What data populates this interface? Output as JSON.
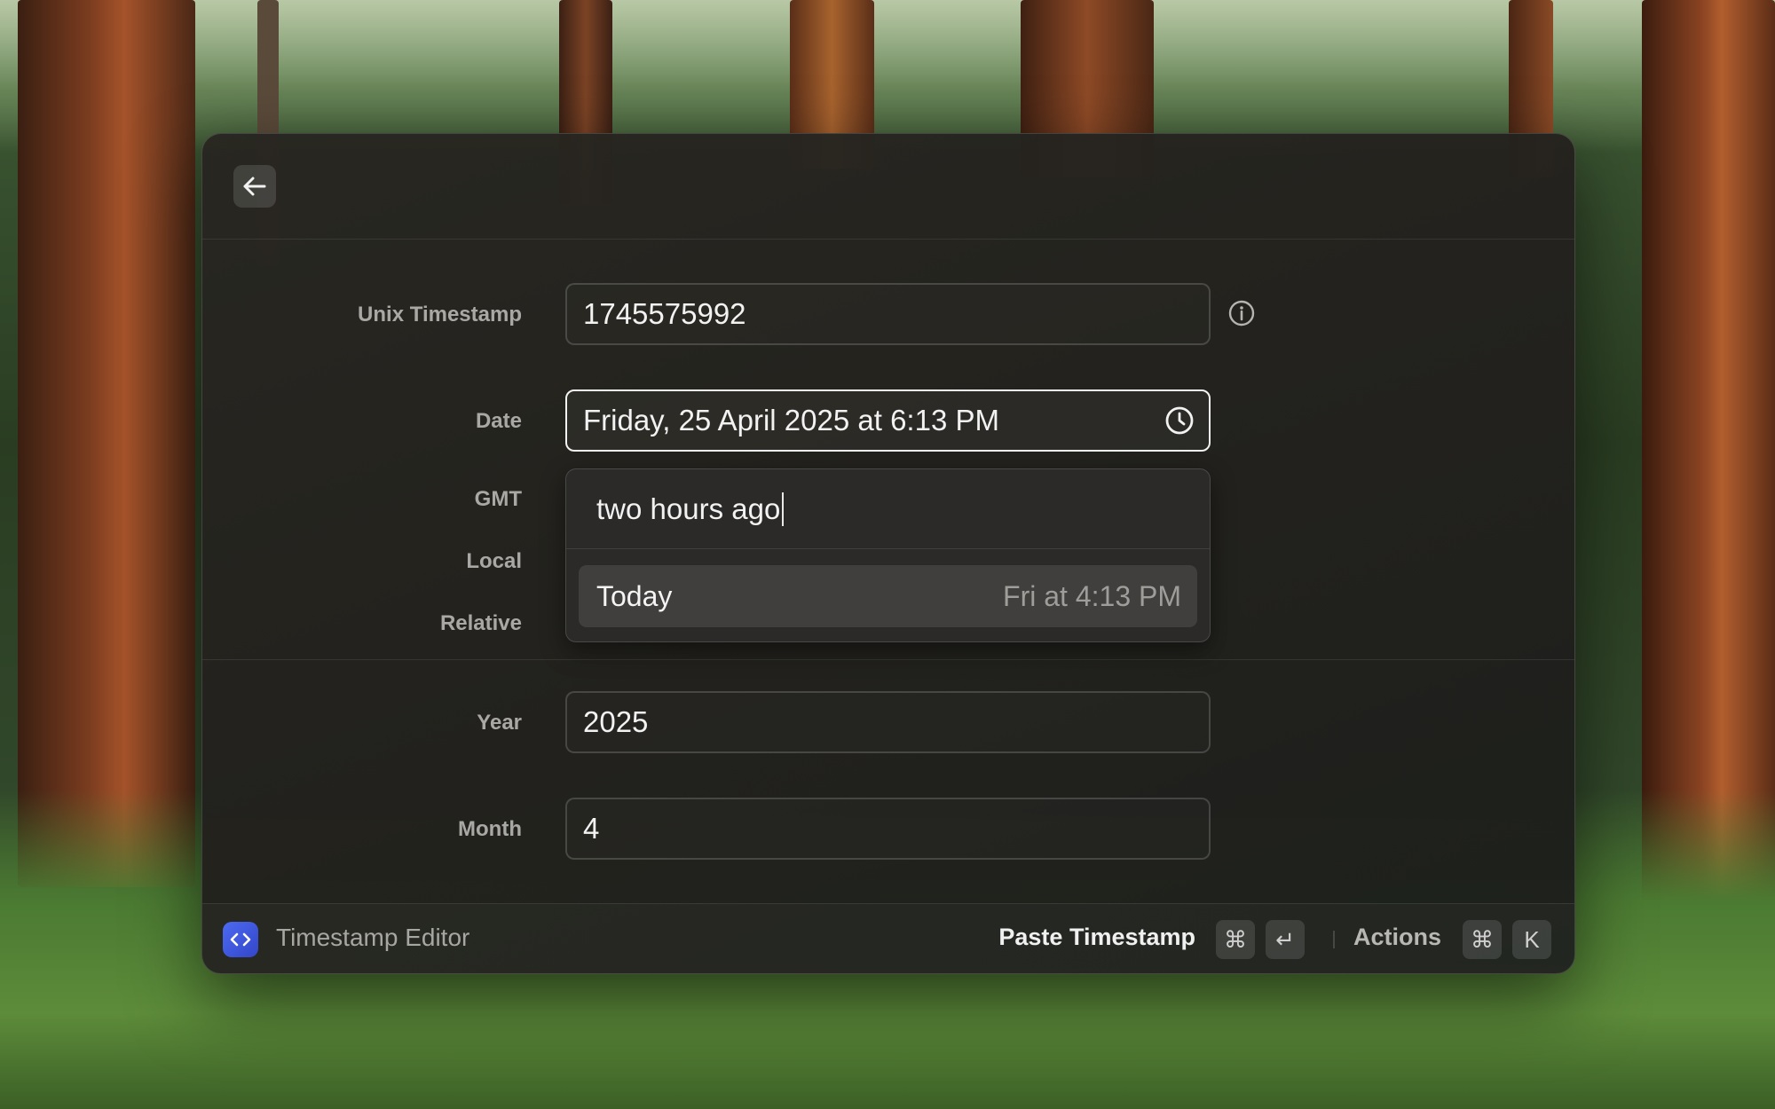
{
  "window": {
    "back_icon": "arrow-left-icon"
  },
  "form": {
    "unix_timestamp": {
      "label": "Unix Timestamp",
      "value": "1745575992",
      "info_icon": "info-icon"
    },
    "date": {
      "label": "Date",
      "value": "Friday, 25 April 2025 at 6:13 PM",
      "icon": "clock-icon"
    },
    "gmt": {
      "label": "GMT"
    },
    "local": {
      "label": "Local"
    },
    "relative": {
      "label": "Relative"
    },
    "year": {
      "label": "Year",
      "value": "2025"
    },
    "month": {
      "label": "Month",
      "value": "4"
    }
  },
  "dropdown": {
    "query": "two hours ago",
    "items": [
      {
        "label": "Today",
        "value": "Fri at 4:13 PM"
      }
    ]
  },
  "footer": {
    "app_name": "Timestamp Editor",
    "app_icon": "code-brackets-icon",
    "primary_action": "Paste Timestamp",
    "primary_shortcut": [
      "⌘",
      "↵"
    ],
    "actions_label": "Actions",
    "actions_shortcut": [
      "⌘",
      "K"
    ]
  },
  "colors": {
    "accent": "#4c6af2",
    "window_bg": "#24231f",
    "focus_border": "#f3f3f3"
  }
}
